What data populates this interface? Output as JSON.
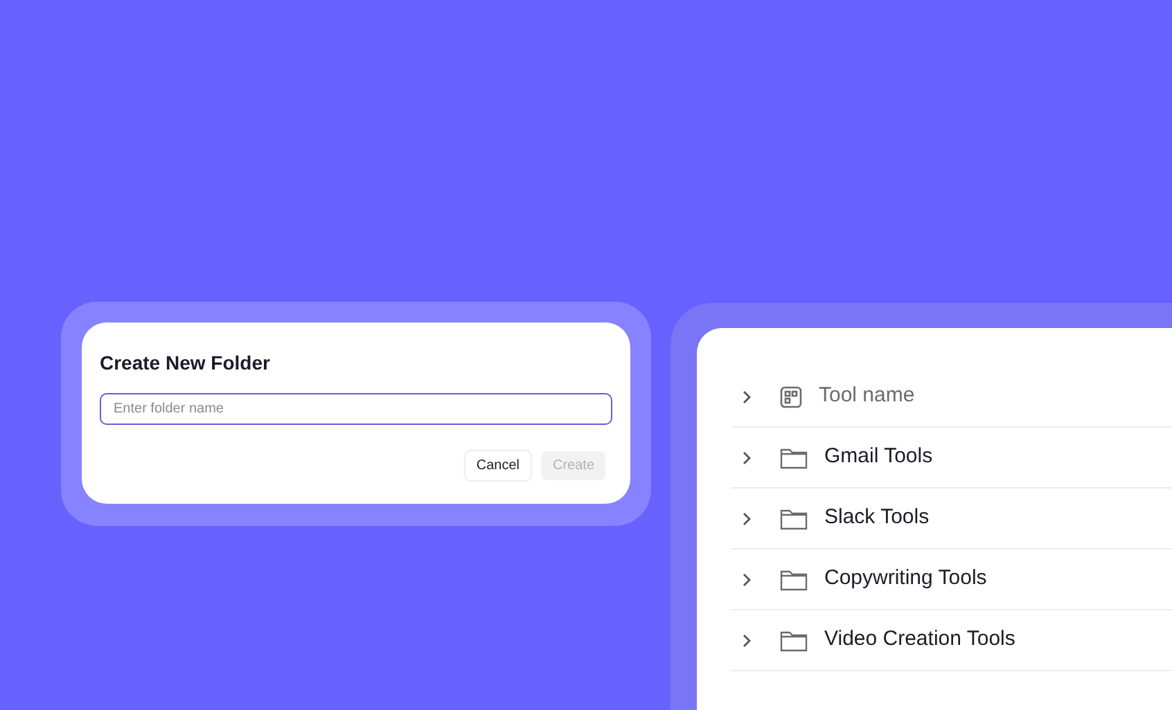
{
  "dialog": {
    "title": "Create New Folder",
    "field": {
      "placeholder": "Enter folder name"
    },
    "buttons": [
      {
        "label": "Cancel",
        "disabled": false
      },
      {
        "label": "Create",
        "disabled": true
      }
    ]
  },
  "tree": {
    "rows": [
      {
        "kind": "header",
        "label": "Tool name",
        "expanded": false
      },
      {
        "kind": "folder",
        "label": "Gmail Tools",
        "expanded": false
      },
      {
        "kind": "folder",
        "label": "Slack Tools",
        "expanded": false
      },
      {
        "kind": "folder",
        "label": "Copywriting Tools",
        "expanded": false
      },
      {
        "kind": "folder",
        "label": "Video Creation Tools",
        "expanded": false
      }
    ]
  }
}
